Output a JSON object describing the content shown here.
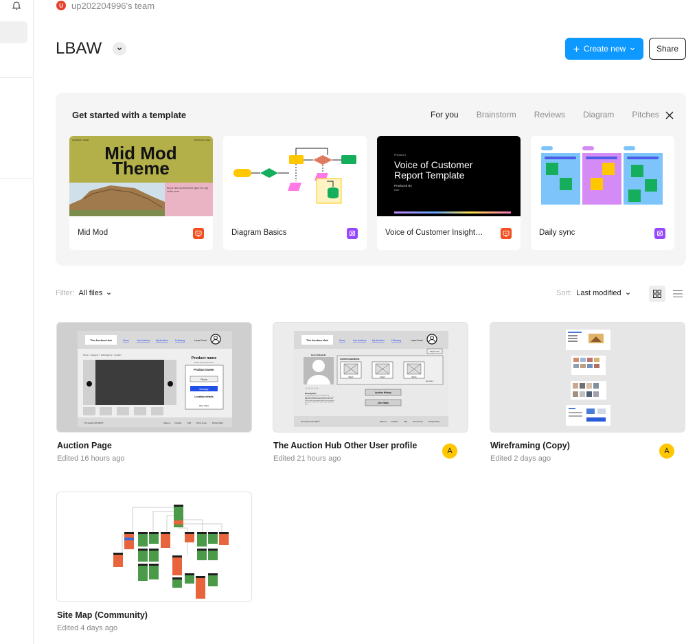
{
  "sidebar": {
    "notifications_icon": "bell-icon"
  },
  "team": {
    "avatar_letter": "U",
    "name": "up202204996's team"
  },
  "project": {
    "title": "LBAW"
  },
  "actions": {
    "create_label": "Create new",
    "share_label": "Share"
  },
  "templates": {
    "heading": "Get started with a template",
    "tabs": [
      {
        "label": "For you",
        "active": true
      },
      {
        "label": "Brainstorm",
        "active": false
      },
      {
        "label": "Reviews",
        "active": false
      },
      {
        "label": "Diagram",
        "active": false
      },
      {
        "label": "Pitches",
        "active": false
      }
    ],
    "cards": [
      {
        "label": "Mid Mod",
        "badge_icon": "slides-icon",
        "badge_color": "#f24e1e",
        "thumb": {
          "title_line1": "Mid Mod",
          "title_line2": "Theme",
          "caption": "Just in case you need more space for copy on the cover.",
          "top_left": "COMPANY NAME",
          "top_right": "MONTH 00, 2024"
        }
      },
      {
        "label": "Diagram Basics",
        "badge_icon": "figjam-icon",
        "badge_color": "#9747ff"
      },
      {
        "label": "Voice of Customer Insight…",
        "badge_icon": "slides-icon",
        "badge_color": "#f24e1e",
        "thumb": {
          "kicker": "PRODUCT",
          "title_line1": "Voice of Customer",
          "title_line2": "Report Template",
          "byline": "Produced By",
          "byline_name": "Date"
        }
      },
      {
        "label": "Daily sync",
        "badge_icon": "figjam-icon",
        "badge_color": "#9747ff"
      }
    ]
  },
  "filter": {
    "label": "Filter:",
    "value": "All files"
  },
  "sort": {
    "label": "Sort:",
    "value": "Last modified"
  },
  "files": [
    {
      "name": "Auction Page",
      "edited": "Edited 16 hours ago",
      "avatar": "",
      "thumb": {
        "logo": "The Auction Hub",
        "nav": [
          "Home",
          "Live Auctions",
          "My Auctions",
          "Following"
        ],
        "user": "Laura Ferrel",
        "breadcrumb": "home > category > subcategory > product",
        "product_name": "Product name",
        "product_desc": "details about the product",
        "owner_title": "Product Owner",
        "phone": "Phone",
        "message": "Message",
        "location": "Location details",
        "other_offers": "Other Offers",
        "footer_left": "The auction hub 2023 ©",
        "footer_links": [
          "About us",
          "Contacts",
          "FAQ",
          "Terms of use",
          "Privacy Policy"
        ]
      }
    },
    {
      "name": "The Auction Hub Other User profile",
      "edited": "Edited 21 hours ago",
      "avatar": "A",
      "thumb": {
        "logo": "The Auction Hub",
        "nav": [
          "Home",
          "Live Auctions",
          "My Auctions",
          "Following"
        ],
        "user": "Laura Ferrel",
        "report": "Report User",
        "profile_name": "Henry Edwards",
        "current_auctions": "Current Auctions",
        "watch": "Watch",
        "see_more": "See more >",
        "description": "Description",
        "desc_text": "A simple dummy text of the printing and typesetting industry. Lorem ipsum has been the industry's standard dummy text ever since the 1500s, when an unknown printer took a galley of type and scrambled it to make a type specimen book.",
        "auction_history": "Auction History",
        "user_stats": "User Stats",
        "footer_left": "The auction hub 2023 ©",
        "footer_links": [
          "About us",
          "Contacts",
          "FAQ",
          "Terms of use",
          "Privacy Policy"
        ]
      }
    },
    {
      "name": "Wireframing (Copy)",
      "edited": "Edited 2 days ago",
      "avatar": "A"
    },
    {
      "name": "Site Map (Community)",
      "edited": "Edited 4 days ago",
      "avatar": ""
    }
  ]
}
